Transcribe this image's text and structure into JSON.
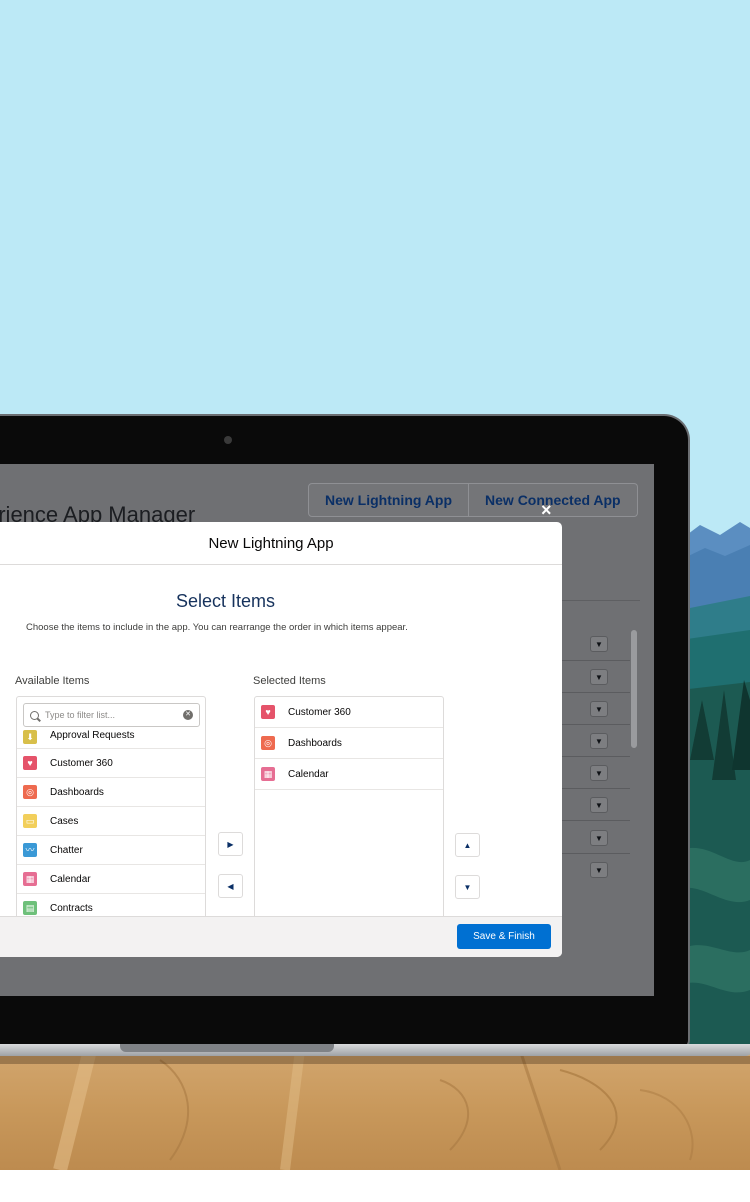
{
  "app": {
    "page_title": "erience App Manager",
    "buttons": {
      "new_lightning_app": "New Lightning App",
      "new_connected_app": "New Connected App"
    }
  },
  "modal": {
    "title": "New Lightning App",
    "close_glyph": "×",
    "section_title": "Select Items",
    "description": "Choose the items to include in the app. You can rearrange the order in which items appear.",
    "available": {
      "label": "Available Items",
      "search_placeholder": "Type to filter list...",
      "items": [
        {
          "label": "Approval Requests",
          "icon": "approval-icon",
          "color": "#d8bf4a"
        },
        {
          "label": "Customer 360",
          "icon": "heart-icon",
          "color": "#e5536a"
        },
        {
          "label": "Dashboards",
          "icon": "dashboard-icon",
          "color": "#ee6a4f"
        },
        {
          "label": "Cases",
          "icon": "case-icon",
          "color": "#f2cf5b"
        },
        {
          "label": "Chatter",
          "icon": "chatter-icon",
          "color": "#3a99d6"
        },
        {
          "label": "Calendar",
          "icon": "calendar-icon",
          "color": "#e66e93"
        },
        {
          "label": "Contracts",
          "icon": "contract-icon",
          "color": "#6ec07a"
        }
      ]
    },
    "selected": {
      "label": "Selected Items",
      "items": [
        {
          "label": "Customer 360",
          "icon": "heart-icon",
          "color": "#e5536a"
        },
        {
          "label": "Dashboards",
          "icon": "dashboard-icon",
          "color": "#ee6a4f"
        },
        {
          "label": "Calendar",
          "icon": "calendar-icon",
          "color": "#e66e93"
        }
      ]
    },
    "save_label": "Save & Finish"
  },
  "colors": {
    "sky": "#bce9f6",
    "brand_button": "#0070d2",
    "link_text": "#0a2f66"
  }
}
